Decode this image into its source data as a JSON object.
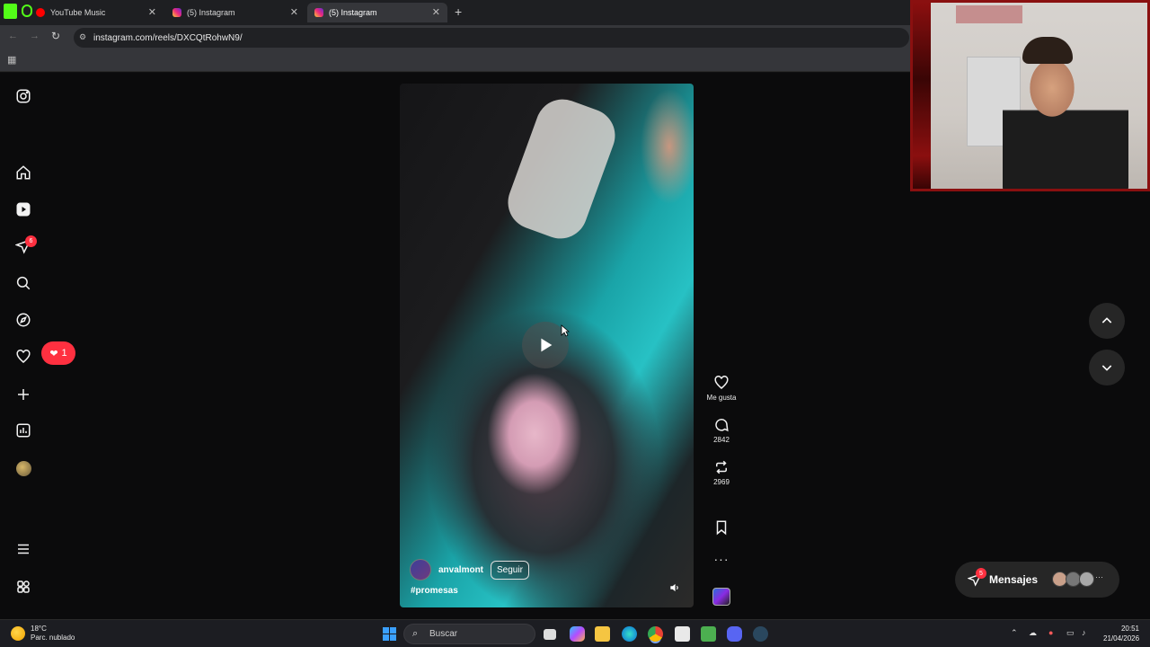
{
  "browser": {
    "tabs": [
      {
        "title": "YouTube Music",
        "favicon": "youtube-music-icon",
        "active": false
      },
      {
        "title": "(5) Instagram",
        "favicon": "instagram-icon",
        "active": false
      },
      {
        "title": "(5) Instagram",
        "favicon": "instagram-icon",
        "active": true
      }
    ],
    "url": "instagram.com/reels/DXCQtRohwN9/"
  },
  "sidebar": {
    "items": [
      {
        "name": "instagram-logo-icon"
      },
      {
        "name": "home-icon"
      },
      {
        "name": "reels-icon"
      },
      {
        "name": "messages-icon",
        "badge": "6"
      },
      {
        "name": "search-icon"
      },
      {
        "name": "explore-icon"
      },
      {
        "name": "notifications-icon"
      },
      {
        "name": "create-icon"
      },
      {
        "name": "dashboard-icon"
      },
      {
        "name": "profile-avatar"
      },
      {
        "name": "more-menu-icon"
      },
      {
        "name": "also-from-meta-icon"
      }
    ],
    "notification_pill": "1"
  },
  "reel": {
    "username": "anvalmont",
    "follow_label": "Seguir",
    "caption": "#promesas",
    "state": "paused"
  },
  "actions": {
    "like_label": "Me gusta",
    "comments": "2842",
    "reposts": "2969"
  },
  "messages": {
    "label": "Mensajes",
    "badge": "5"
  },
  "taskbar": {
    "weather_temp": "18°C",
    "weather_desc": "Parc. nublado",
    "search_placeholder": "Buscar",
    "time": "20:51",
    "date": "21/04/2026"
  },
  "colors": {
    "badge_red": "#ff3040",
    "page_bg": "#0b0b0c",
    "windows_blue": "#3aa0ff"
  }
}
